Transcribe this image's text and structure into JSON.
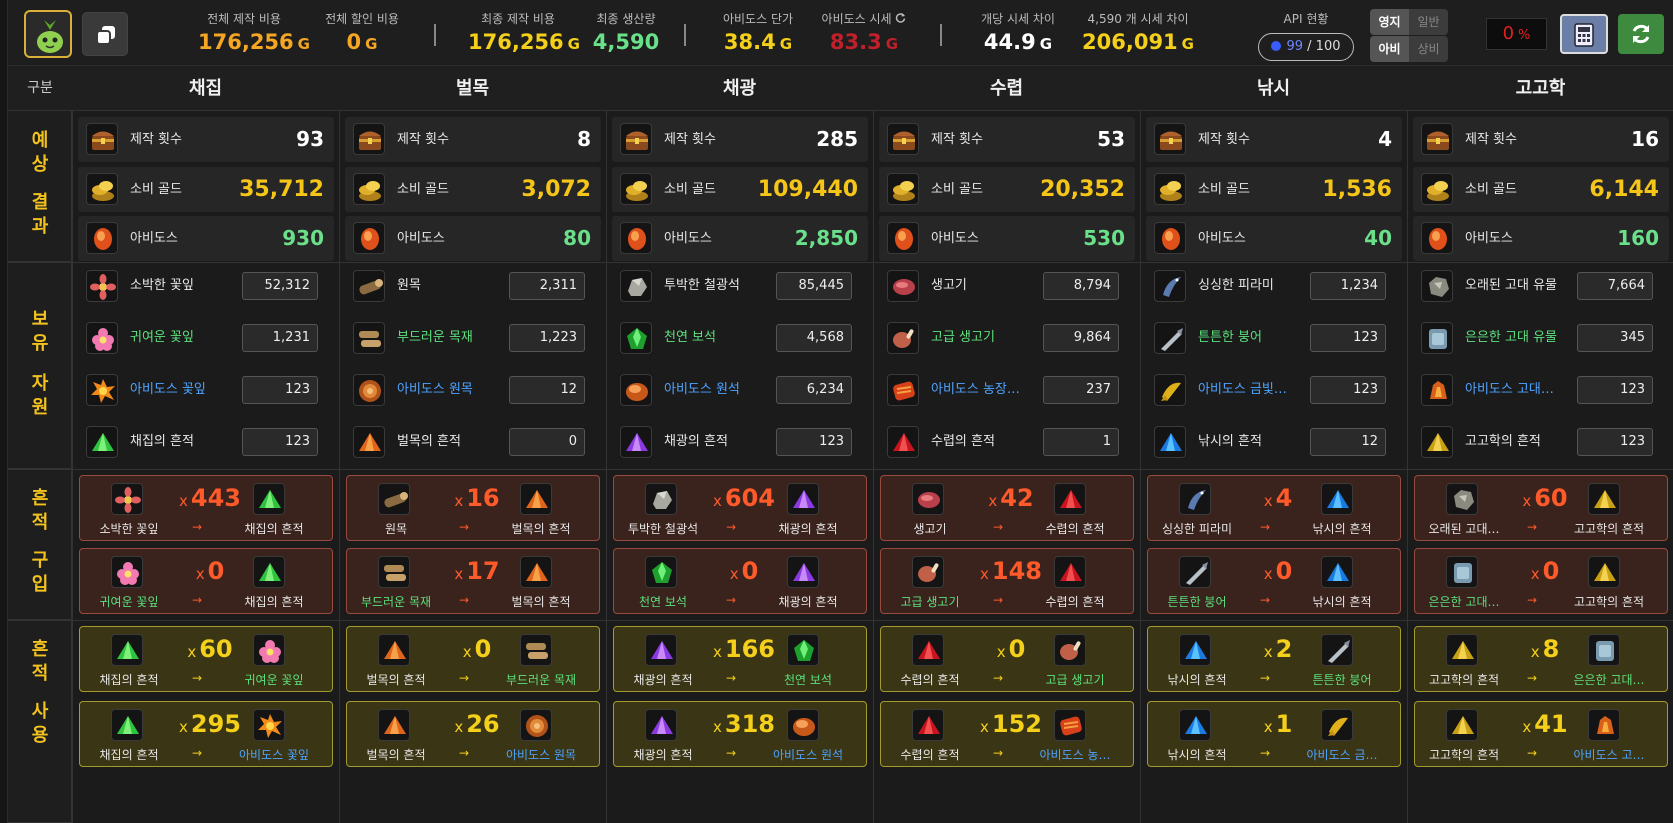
{
  "topbar": {
    "stats": [
      {
        "label": "전체 제작 비용",
        "value": "176,256",
        "unit": "G",
        "color": "#f5a623"
      },
      {
        "label": "전체 할인 비용",
        "value": "0",
        "unit": "G",
        "color": "#f5a623"
      },
      {
        "label": "최종 제작 비용",
        "value": "176,256",
        "unit": "G",
        "color": "#f5d01a"
      },
      {
        "label": "최종 생산량",
        "value": "4,590",
        "unit": "",
        "color": "#6ae08a"
      },
      {
        "label": "아비도스 단가",
        "value": "38.4",
        "unit": "G",
        "color": "#f5d01a"
      },
      {
        "label": "아비도스 시세",
        "value": "83.3",
        "unit": "G",
        "color": "#c0202a"
      },
      {
        "label": "개당 시세 차이",
        "value": "44.9",
        "unit": "G",
        "color": "#ffffff"
      },
      {
        "label": "4,590 개 시세 차이",
        "value": "206,091",
        "unit": "G",
        "color": "#f5d01a"
      }
    ],
    "api": {
      "label": "API 현황",
      "used": "99",
      "total": "/ 100"
    },
    "toggle1": {
      "on": "영지",
      "off": "일반"
    },
    "toggle2": {
      "on": "아비",
      "off": "상비"
    },
    "discount": {
      "value": "0",
      "unit": "%"
    }
  },
  "header": {
    "first": "구분",
    "columns": [
      "채집",
      "벌목",
      "채광",
      "수렵",
      "낚시",
      "고고학"
    ]
  },
  "sections": {
    "result": [
      "예",
      "상",
      "결",
      "과"
    ],
    "owned": [
      "보",
      "유",
      "자",
      "원"
    ],
    "buy": [
      "흔",
      "적",
      "구",
      "입"
    ],
    "use": [
      "흔",
      "적",
      "사",
      "용"
    ]
  },
  "result_labels": {
    "count": "제작 횟수",
    "gold": "소비 골드",
    "abydos": "아비도스"
  },
  "arrow": "→",
  "x": "x",
  "columns": [
    {
      "name": "채집",
      "results": {
        "count": "93",
        "gold": "35,712",
        "abydos": "930"
      },
      "resources": [
        {
          "name": "소박한 꽃잎",
          "value": "52,312",
          "color": "white",
          "icon": "flower-icon"
        },
        {
          "name": "귀여운 꽃잎",
          "value": "1,231",
          "color": "green",
          "icon": "pink-flower-icon"
        },
        {
          "name": "아비도스 꽃잎",
          "value": "123",
          "color": "blue",
          "icon": "fire-flower-icon"
        },
        {
          "name": "채집의 흔적",
          "value": "123",
          "color": "white",
          "icon": "green-powder-icon"
        }
      ],
      "buy": [
        {
          "from": "소박한 꽃잎",
          "mult": "443",
          "to": "채집의 흔적",
          "fromColor": "white",
          "toColor": "white",
          "fromIcon": "flower-icon",
          "toIcon": "green-powder-icon"
        },
        {
          "from": "귀여운 꽃잎",
          "mult": "0",
          "to": "채집의 흔적",
          "fromColor": "green",
          "toColor": "white",
          "fromIcon": "pink-flower-icon",
          "toIcon": "green-powder-icon"
        }
      ],
      "use": [
        {
          "from": "채집의 흔적",
          "mult": "60",
          "to": "귀여운 꽃잎",
          "fromColor": "white",
          "toColor": "green",
          "fromIcon": "green-powder-icon",
          "toIcon": "pink-flower-icon"
        },
        {
          "from": "채집의 흔적",
          "mult": "295",
          "to": "아비도스 꽃잎",
          "fromColor": "white",
          "toColor": "blue",
          "fromIcon": "green-powder-icon",
          "toIcon": "fire-flower-icon"
        }
      ]
    },
    {
      "name": "벌목",
      "results": {
        "count": "8",
        "gold": "3,072",
        "abydos": "80"
      },
      "resources": [
        {
          "name": "원목",
          "value": "2,311",
          "color": "white",
          "icon": "log-icon"
        },
        {
          "name": "부드러운 목재",
          "value": "1,223",
          "color": "green",
          "icon": "soft-wood-icon"
        },
        {
          "name": "아비도스 원목",
          "value": "12",
          "color": "blue",
          "icon": "abydos-log-icon"
        },
        {
          "name": "벌목의 흔적",
          "value": "0",
          "color": "white",
          "icon": "orange-powder-icon"
        }
      ],
      "buy": [
        {
          "from": "원목",
          "mult": "16",
          "to": "벌목의 흔적",
          "fromColor": "white",
          "toColor": "white",
          "fromIcon": "log-icon",
          "toIcon": "orange-powder-icon"
        },
        {
          "from": "부드러운 목재",
          "mult": "17",
          "to": "벌목의 흔적",
          "fromColor": "green",
          "toColor": "white",
          "fromIcon": "soft-wood-icon",
          "toIcon": "orange-powder-icon"
        }
      ],
      "use": [
        {
          "from": "벌목의 흔적",
          "mult": "0",
          "to": "부드러운 목재",
          "fromColor": "white",
          "toColor": "green",
          "fromIcon": "orange-powder-icon",
          "toIcon": "soft-wood-icon"
        },
        {
          "from": "벌목의 흔적",
          "mult": "26",
          "to": "아비도스 원목",
          "fromColor": "white",
          "toColor": "blue",
          "fromIcon": "orange-powder-icon",
          "toIcon": "abydos-log-icon"
        }
      ]
    },
    {
      "name": "채광",
      "results": {
        "count": "285",
        "gold": "109,440",
        "abydos": "2,850"
      },
      "resources": [
        {
          "name": "투박한 철광석",
          "value": "85,445",
          "color": "white",
          "icon": "ore-icon"
        },
        {
          "name": "천연 보석",
          "value": "4,568",
          "color": "green",
          "icon": "gem-icon"
        },
        {
          "name": "아비도스 원석",
          "value": "6,234",
          "color": "blue",
          "icon": "abydos-ore-icon"
        },
        {
          "name": "채광의 흔적",
          "value": "123",
          "color": "white",
          "icon": "purple-powder-icon"
        }
      ],
      "buy": [
        {
          "from": "투박한 철광석",
          "mult": "604",
          "to": "채광의 흔적",
          "fromColor": "white",
          "toColor": "white",
          "fromIcon": "ore-icon",
          "toIcon": "purple-powder-icon"
        },
        {
          "from": "천연 보석",
          "mult": "0",
          "to": "채광의 흔적",
          "fromColor": "green",
          "toColor": "white",
          "fromIcon": "gem-icon",
          "toIcon": "purple-powder-icon"
        }
      ],
      "use": [
        {
          "from": "채광의 흔적",
          "mult": "166",
          "to": "천연 보석",
          "fromColor": "white",
          "toColor": "green",
          "fromIcon": "purple-powder-icon",
          "toIcon": "gem-icon"
        },
        {
          "from": "채광의 흔적",
          "mult": "318",
          "to": "아비도스 원석",
          "fromColor": "white",
          "toColor": "blue",
          "fromIcon": "purple-powder-icon",
          "toIcon": "abydos-ore-icon"
        }
      ]
    },
    {
      "name": "수렵",
      "results": {
        "count": "53",
        "gold": "20,352",
        "abydos": "530"
      },
      "resources": [
        {
          "name": "생고기",
          "value": "8,794",
          "color": "white",
          "icon": "meat-icon"
        },
        {
          "name": "고급 생고기",
          "value": "9,864",
          "color": "green",
          "icon": "fine-meat-icon"
        },
        {
          "name": "아비도스 농장…",
          "value": "237",
          "color": "blue",
          "icon": "abydos-meat-icon"
        },
        {
          "name": "수렵의 흔적",
          "value": "1",
          "color": "white",
          "icon": "red-powder-icon"
        }
      ],
      "buy": [
        {
          "from": "생고기",
          "mult": "42",
          "to": "수렵의 흔적",
          "fromColor": "white",
          "toColor": "white",
          "fromIcon": "meat-icon",
          "toIcon": "red-powder-icon"
        },
        {
          "from": "고급 생고기",
          "mult": "148",
          "to": "수렵의 흔적",
          "fromColor": "green",
          "toColor": "white",
          "fromIcon": "fine-meat-icon",
          "toIcon": "red-powder-icon"
        }
      ],
      "use": [
        {
          "from": "수렵의 흔적",
          "mult": "0",
          "to": "고급 생고기",
          "fromColor": "white",
          "toColor": "green",
          "fromIcon": "red-powder-icon",
          "toIcon": "fine-meat-icon"
        },
        {
          "from": "수렵의 흔적",
          "mult": "152",
          "to": "아비도스 농…",
          "fromColor": "white",
          "toColor": "blue",
          "fromIcon": "red-powder-icon",
          "toIcon": "abydos-meat-icon"
        }
      ]
    },
    {
      "name": "낚시",
      "results": {
        "count": "4",
        "gold": "1,536",
        "abydos": "40"
      },
      "resources": [
        {
          "name": "싱싱한 피라미",
          "value": "1,234",
          "color": "white",
          "icon": "fish-icon"
        },
        {
          "name": "튼튼한 붕어",
          "value": "123",
          "color": "green",
          "icon": "carp-icon"
        },
        {
          "name": "아비도스 금빛…",
          "value": "123",
          "color": "blue",
          "icon": "golden-fish-icon"
        },
        {
          "name": "낚시의 흔적",
          "value": "12",
          "color": "white",
          "icon": "blue-powder-icon"
        }
      ],
      "buy": [
        {
          "from": "싱싱한 피라미",
          "mult": "4",
          "to": "낚시의 흔적",
          "fromColor": "white",
          "toColor": "white",
          "fromIcon": "fish-icon",
          "toIcon": "blue-powder-icon"
        },
        {
          "from": "튼튼한 붕어",
          "mult": "0",
          "to": "낚시의 흔적",
          "fromColor": "green",
          "toColor": "white",
          "fromIcon": "carp-icon",
          "toIcon": "blue-powder-icon"
        }
      ],
      "use": [
        {
          "from": "낚시의 흔적",
          "mult": "2",
          "to": "튼튼한 붕어",
          "fromColor": "white",
          "toColor": "green",
          "fromIcon": "blue-powder-icon",
          "toIcon": "carp-icon"
        },
        {
          "from": "낚시의 흔적",
          "mult": "1",
          "to": "아비도스 금…",
          "fromColor": "white",
          "toColor": "blue",
          "fromIcon": "blue-powder-icon",
          "toIcon": "golden-fish-icon"
        }
      ]
    },
    {
      "name": "고고학",
      "results": {
        "count": "16",
        "gold": "6,144",
        "abydos": "160"
      },
      "resources": [
        {
          "name": "오래된 고대 유물",
          "value": "7,664",
          "color": "white",
          "icon": "relic-icon"
        },
        {
          "name": "은은한 고대 유물",
          "value": "345",
          "color": "green",
          "icon": "tablet-icon"
        },
        {
          "name": "아비도스 고대…",
          "value": "123",
          "color": "blue",
          "icon": "abydos-relic-icon"
        },
        {
          "name": "고고학의 흔적",
          "value": "123",
          "color": "white",
          "icon": "yellow-powder-icon"
        }
      ],
      "buy": [
        {
          "from": "오래된 고대…",
          "mult": "60",
          "to": "고고학의 흔적",
          "fromColor": "white",
          "toColor": "white",
          "fromIcon": "relic-icon",
          "toIcon": "yellow-powder-icon"
        },
        {
          "from": "은은한 고대…",
          "mult": "0",
          "to": "고고학의 흔적",
          "fromColor": "green",
          "toColor": "white",
          "fromIcon": "tablet-icon",
          "toIcon": "yellow-powder-icon"
        }
      ],
      "use": [
        {
          "from": "고고학의 흔적",
          "mult": "8",
          "to": "은은한 고대…",
          "fromColor": "white",
          "toColor": "green",
          "fromIcon": "yellow-powder-icon",
          "toIcon": "tablet-icon"
        },
        {
          "from": "고고학의 흔적",
          "mult": "41",
          "to": "아비도스 고…",
          "fromColor": "white",
          "toColor": "blue",
          "fromIcon": "yellow-powder-icon",
          "toIcon": "abydos-relic-icon"
        }
      ]
    }
  ]
}
